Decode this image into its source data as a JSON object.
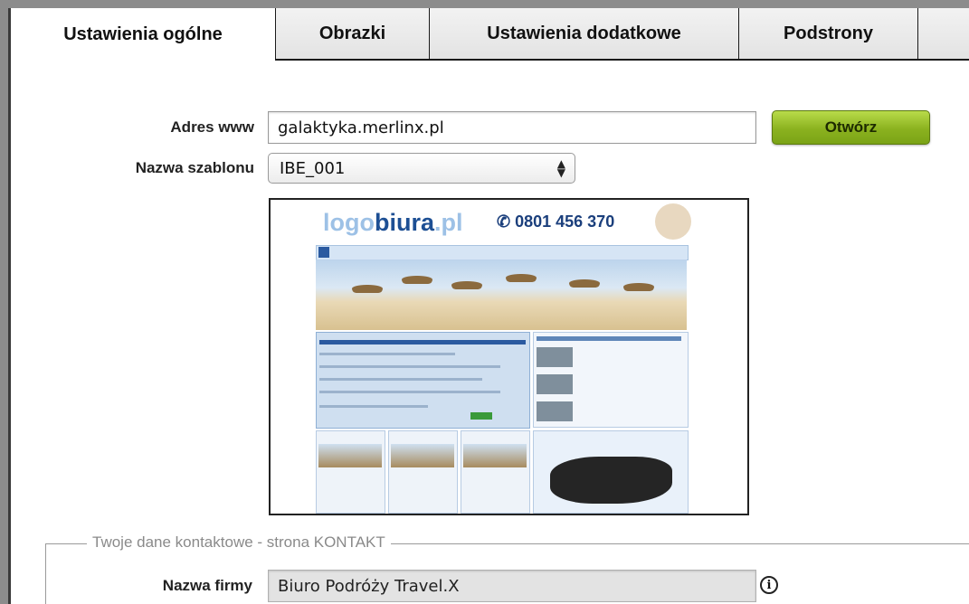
{
  "tabs": [
    {
      "label": "Ustawienia ogólne",
      "active": true
    },
    {
      "label": "Obrazki",
      "active": false
    },
    {
      "label": "Ustawienia dodatkowe",
      "active": false
    },
    {
      "label": "Podstrony",
      "active": false
    }
  ],
  "form": {
    "website": {
      "label": "Adres www",
      "value": "galaktyka.merlinx.pl"
    },
    "open_button": "Otwórz",
    "template": {
      "label": "Nazwa szablonu",
      "selected": "IBE_001"
    }
  },
  "preview": {
    "logo_prefix": "logo",
    "logo_brand": "biura",
    "logo_suffix": ".pl",
    "phone": "0801 456 370"
  },
  "contact_section": {
    "legend": "Twoje dane kontaktowe - strona KONTAKT",
    "company": {
      "label": "Nazwa firmy",
      "value": "Biuro Podróży Travel.X"
    },
    "info_glyph": "i"
  },
  "colors": {
    "open_button": "#8bb21f",
    "frame": "#8c8c8c"
  },
  "icons": {
    "select_arrows": "updown-arrows-icon",
    "info": "info-icon"
  }
}
